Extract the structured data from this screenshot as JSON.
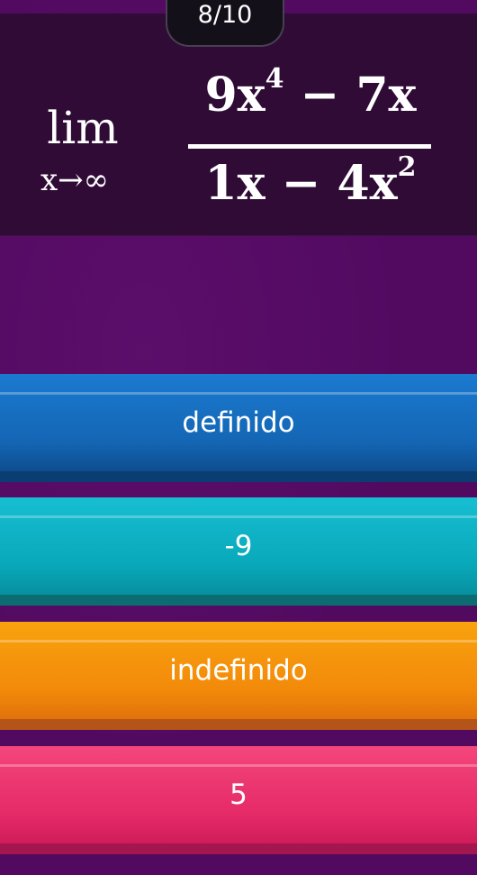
{
  "counter": "8/10",
  "question": {
    "lim_word": "lim",
    "lim_sub": "x→∞",
    "numerator_term1": "9x",
    "numerator_exp": "4",
    "numerator_rest": " − 7x",
    "denominator_term": "1x − 4x",
    "denominator_exp": "2"
  },
  "options": [
    {
      "label": "definido",
      "color": "#1466b4"
    },
    {
      "label": "-9",
      "color": "#08a8b9"
    },
    {
      "label": "indefinido",
      "color": "#f28a0a"
    },
    {
      "label": "5",
      "color": "#e52a68"
    }
  ]
}
